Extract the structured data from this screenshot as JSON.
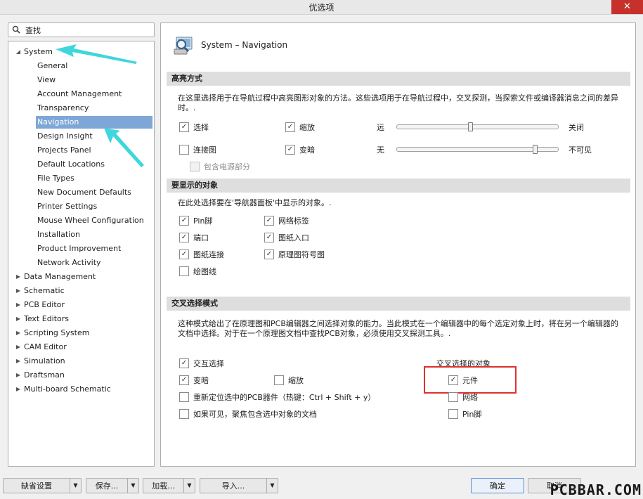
{
  "window": {
    "title": "优选项",
    "close_glyph": "✕"
  },
  "search": {
    "value": "查找",
    "icon": "search-icon"
  },
  "tree": {
    "system": "System",
    "children": [
      "General",
      "View",
      "Account Management",
      "Transparency",
      "Navigation",
      "Design Insight",
      "Projects Panel",
      "Default Locations",
      "File Types",
      "New Document Defaults",
      "Printer Settings",
      "Mouse Wheel Configuration",
      "Installation",
      "Product Improvement",
      "Network Activity"
    ],
    "selected": "Navigation",
    "collapsed": [
      "Data Management",
      "Schematic",
      "PCB Editor",
      "Text Editors",
      "Scripting System",
      "CAM Editor",
      "Simulation",
      "Draftsman",
      "Multi-board Schematic"
    ]
  },
  "header": {
    "title": "System – Navigation",
    "icon": "navigation-magnifier-icon"
  },
  "highlight": {
    "title": "高亮方式",
    "desc": "在这里选择用于在导航过程中高亮图形对象的方法。这些选项用于在导航过程中，交叉探测，当探索文件或编译器消息之间的差异时。.",
    "select": {
      "label": "选择",
      "checked": true
    },
    "zoom": {
      "label": "缩放",
      "checked": true
    },
    "connect": {
      "label": "连接图",
      "checked": false
    },
    "dim": {
      "label": "变暗",
      "checked": true
    },
    "power": {
      "label": "包含电源部分",
      "checked": false
    },
    "slider1": {
      "left": "远",
      "right": "关闭",
      "level": 0.46
    },
    "slider2": {
      "left": "无",
      "right": "不可见",
      "level": 0.86
    }
  },
  "objects": {
    "title": "要显示的对象",
    "desc": "在此处选择要在'导航器面板'中显示的对象。.",
    "items": [
      {
        "label": "Pin脚",
        "checked": true
      },
      {
        "label": "网络标签",
        "checked": true
      },
      {
        "label": "端口",
        "checked": true
      },
      {
        "label": "图纸入口",
        "checked": true
      },
      {
        "label": "图纸连接",
        "checked": true
      },
      {
        "label": "原理图符号图",
        "checked": true
      },
      {
        "label": "绘图线",
        "checked": false
      }
    ]
  },
  "cross": {
    "title": "交叉选择模式",
    "desc": "这种模式给出了在原理图和PCB编辑器之间选择对象的能力。当此模式在一个编辑器中的每个选定对象上时，将在另一个编辑器的文档中选择。对于在一个原理图文档中查找PCB对象，必须使用交叉探测工具。.",
    "interactive": {
      "label": "交互选择",
      "checked": true
    },
    "dim": {
      "label": "变暗",
      "checked": true
    },
    "zoom": {
      "label": "缩放",
      "checked": false
    },
    "reposition": {
      "label": "重新定位选中的PCB器件（热键：Ctrl + Shift + y）",
      "checked": false
    },
    "focus": {
      "label": "如果可见，聚焦包含选中对象的文档",
      "checked": false
    },
    "target_title": "交叉选择的对象",
    "components": {
      "label": "元件",
      "checked": true
    },
    "nets": {
      "label": "网络",
      "checked": false
    },
    "pins": {
      "label": "Pin脚",
      "checked": false
    }
  },
  "buttons": {
    "defaults": "缺省设置",
    "save": "保存...",
    "load": "加载...",
    "import": "导入...",
    "ok": "确定",
    "cancel": "取消"
  },
  "watermark": "PCBBAR.COM",
  "colors": {
    "selected": "#7ea7d8",
    "annotation": "#3fd6dc",
    "highlight_box": "#e0302c"
  }
}
